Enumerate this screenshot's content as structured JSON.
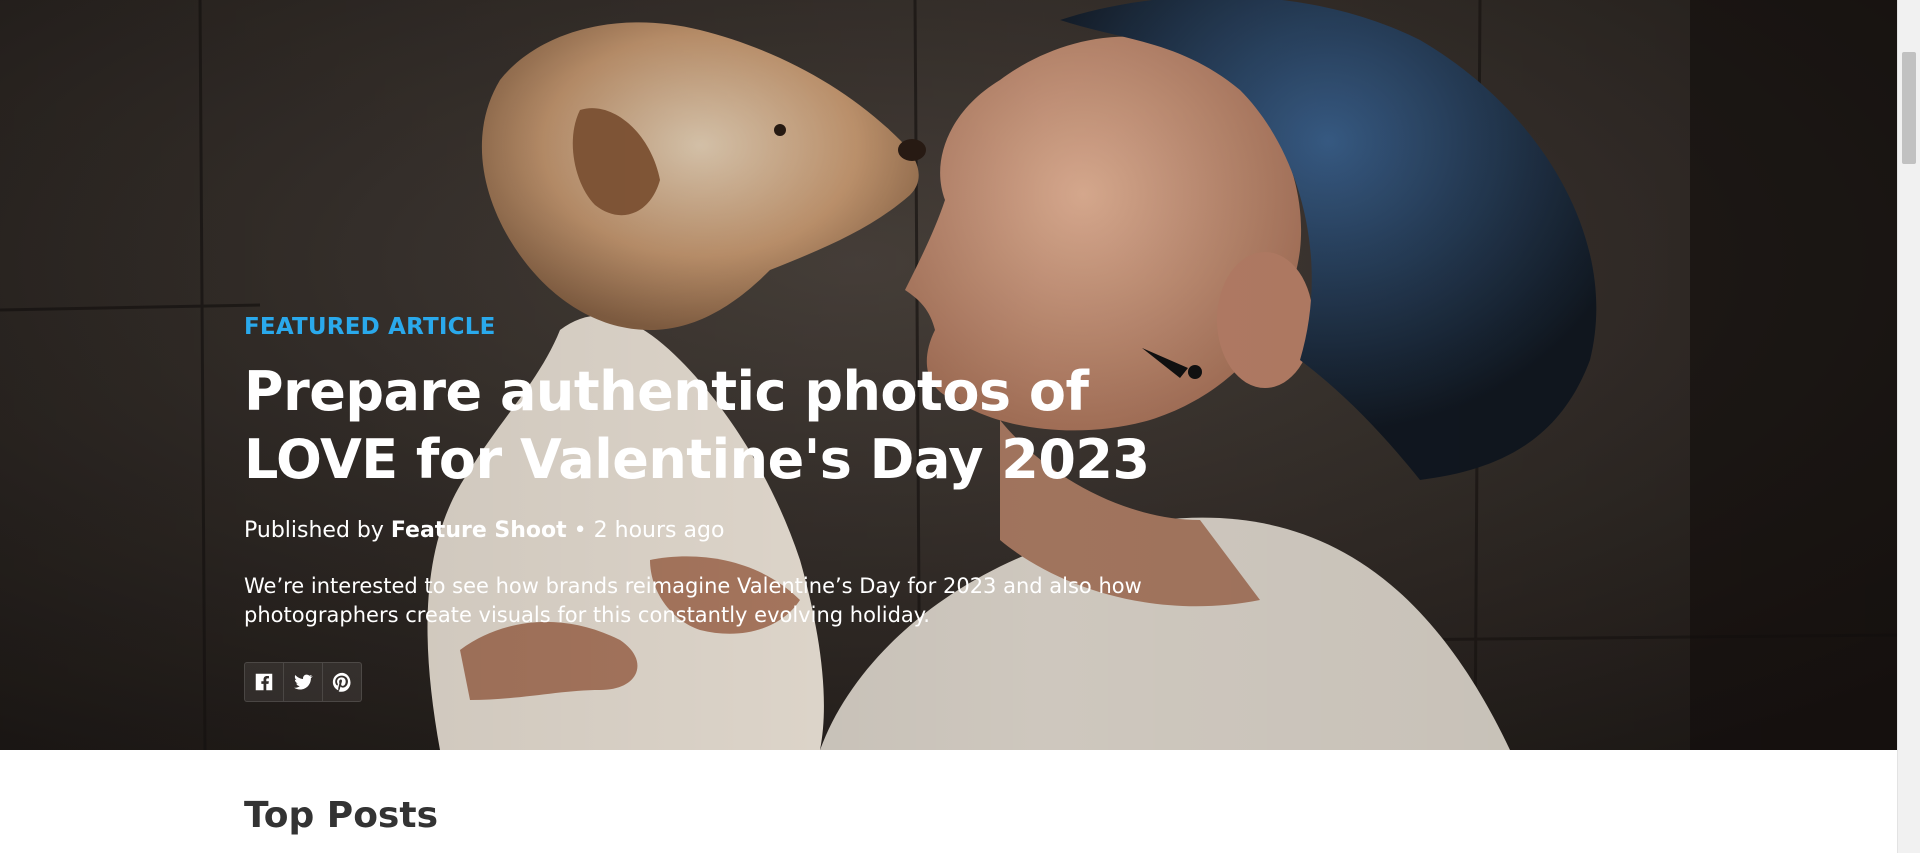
{
  "hero": {
    "eyebrow": "FEATURED ARTICLE",
    "headline_line1": "Prepare authentic photos of",
    "headline_line2": "LOVE for Valentine's Day 2023",
    "byline_prefix": "Published by",
    "author": "Feature Shoot",
    "separator": "•",
    "time_ago": "2 hours ago",
    "summary": "We’re interested to see how brands reimagine Valentine’s Day for 2023 and also how photographers create visuals for this constantly evolving holiday.",
    "share_icons": [
      "facebook-icon",
      "twitter-icon",
      "pinterest-icon"
    ]
  },
  "sections": {
    "top_posts_title": "Top Posts"
  },
  "colors": {
    "accent": "#2aa9ec",
    "heading_dark": "#333333"
  }
}
